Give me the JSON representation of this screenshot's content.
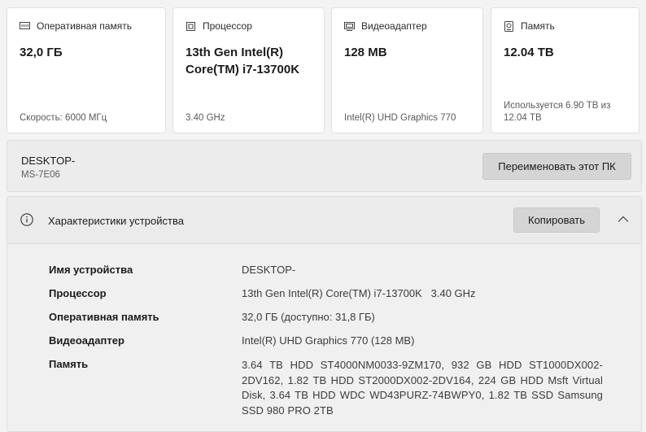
{
  "cards": [
    {
      "icon": "memory-icon",
      "label": "Оперативная память",
      "value": "32,0 ГБ",
      "footer": "Скорость: 6000 МГц"
    },
    {
      "icon": "processor-icon",
      "label": "Процессор",
      "value": "13th Gen Intel(R) Core(TM) i7-13700K",
      "footer": "3.40 GHz"
    },
    {
      "icon": "display-adapter-icon",
      "label": "Видеоадаптер",
      "value": "128 MB",
      "footer": "Intel(R) UHD Graphics 770"
    },
    {
      "icon": "storage-icon",
      "label": "Память",
      "value": "12.04 TB",
      "footer": "Используется 6.90 TB из 12.04 TB"
    }
  ],
  "device": {
    "name": "DESKTOP-",
    "model": "MS-7E06",
    "rename_label": "Переименовать этот ПК"
  },
  "specs": {
    "title": "Характеристики устройства",
    "copy_label": "Копировать",
    "rows": [
      {
        "key": "Имя устройства",
        "value": "DESKTOP-"
      },
      {
        "key": "Процессор",
        "value": "13th Gen Intel(R) Core(TM) i7-13700K   3.40 GHz"
      },
      {
        "key": "Оперативная память",
        "value": "32,0 ГБ (доступно: 31,8 ГБ)"
      },
      {
        "key": "Видеоадаптер",
        "value": "Intel(R) UHD Graphics 770 (128 MB)"
      },
      {
        "key": "Память",
        "value": "3.64 TB HDD ST4000NM0033-9ZM170, 932 GB HDD ST1000DX002-2DV162, 1.82 TB HDD ST2000DX002-2DV164, 224 GB HDD Msft Virtual Disk, 3.64 TB HDD WDC WD43PURZ-74BWPY0, 1.82 TB SSD Samsung SSD 980 PRO 2TB"
      }
    ]
  }
}
